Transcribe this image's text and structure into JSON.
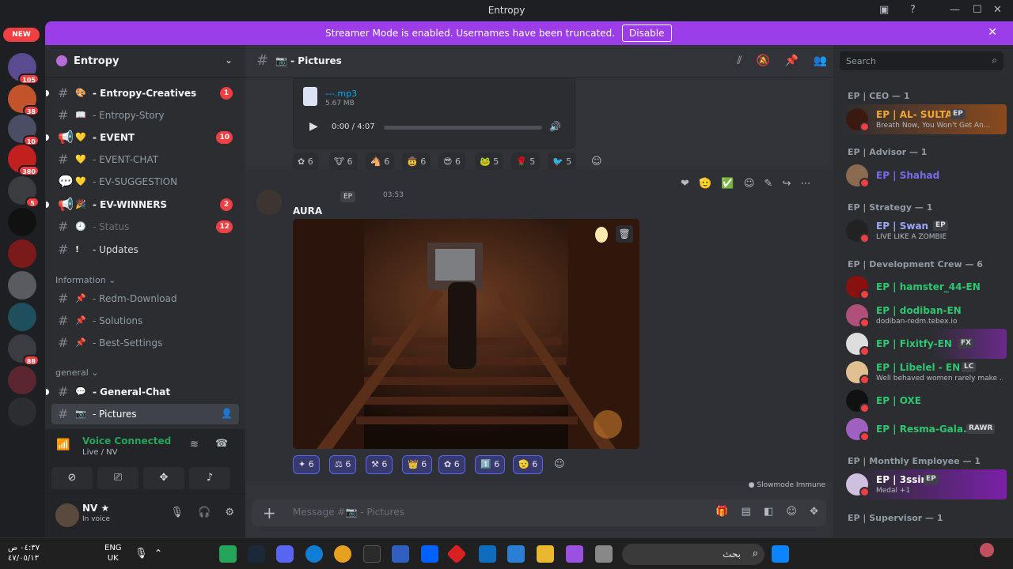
{
  "window": {
    "title": "Entropy"
  },
  "banner": {
    "message": "Streamer Mode is enabled. Usernames have been truncated.",
    "disable_label": "Disable"
  },
  "rail": {
    "new_label": "NEW",
    "badges": [
      "105",
      "38",
      "10",
      "380",
      "5",
      "88"
    ]
  },
  "guild": {
    "name": "Entropy"
  },
  "channels": [
    {
      "label": "- Entropy-Creatives",
      "count": "1"
    },
    {
      "label": "- Entropy-Story"
    },
    {
      "label": "- EVENT",
      "count": "10"
    },
    {
      "label": "- EVENT-CHAT"
    },
    {
      "label": "- EV-SUGGESTION"
    },
    {
      "label": "- EV-WINNERS",
      "count": "2"
    },
    {
      "label": "- Status",
      "count": "12"
    },
    {
      "label": "- Updates"
    }
  ],
  "categories": {
    "information": "Information",
    "general": "general"
  },
  "info_channels": [
    "- Redm-Download",
    "- Solutions",
    "- Best-Settings"
  ],
  "general_channels": [
    "- General-Chat",
    "- Pictures"
  ],
  "voice": {
    "status": "Voice Connected",
    "location": "Live / NV"
  },
  "user": {
    "name": "NV ★",
    "status": "In voice"
  },
  "channel_header": {
    "name": "- Pictures"
  },
  "audio": {
    "filename": "---.mp3",
    "size": "5.67 MB",
    "time": "0:00 / 4:07"
  },
  "reactions_top": [
    "6",
    "6",
    "6",
    "6",
    "6",
    "5",
    "5",
    "5"
  ],
  "message": {
    "tag": "EP",
    "time": "03:53",
    "text": "AURA"
  },
  "reactions_bottom": [
    "6",
    "6",
    "6",
    "6",
    "6",
    "6",
    "6"
  ],
  "slowmode": "Slowmode Immune",
  "composer": {
    "placeholder": "Message #📷 - Pictures"
  },
  "search": {
    "placeholder": "Search"
  },
  "member_groups": {
    "ceo": "EP | CEO — 1",
    "advisor": "EP | Advisor — 1",
    "strategy": "EP | Strategy — 1",
    "dev": "EP | Development Crew — 6",
    "monthly": "EP | Monthly Employee — 1",
    "supervisor": "EP | Supervisor — 1"
  },
  "members": {
    "ceo": {
      "name": "EP | AL- SULTAN",
      "tag": "EP",
      "status": "Breath Now, You Won't Get An..."
    },
    "advisor": {
      "name": "EP | Shahad"
    },
    "strategy": {
      "name": "EP | Swan",
      "tag": "EP",
      "status": "LIVE LIKE A ZOMBIE"
    },
    "dev1": {
      "name": "EP | hamster_44-EN"
    },
    "dev2": {
      "name": "EP | dodiban-EN",
      "status": "dodiban-redm.tebex.io"
    },
    "dev3": {
      "name": "EP | Fixitfy-EN",
      "tag": "FX"
    },
    "dev4": {
      "name": "EP | Libelel - EN",
      "tag": "LC",
      "status": "Well behaved women rarely make ..."
    },
    "dev5": {
      "name": "EP | OXE"
    },
    "dev6": {
      "name": "EP | Resma-Gala...",
      "tag": "RAWR"
    },
    "monthly": {
      "name": "EP | 3ssiri",
      "tag": "EP",
      "status": "Medal +1"
    }
  },
  "taskbar": {
    "time": "٠٤:٣٧ ص",
    "date": "٤٧/٠٥/١٣",
    "lang1": "ENG",
    "lang2": "UK",
    "search": "بحث"
  },
  "colors": {
    "banner": "#9b3de8",
    "accent": "#5865f2",
    "online": "#23a55a",
    "badge": "#f23f43",
    "member_green": "#2dc770",
    "ceo_gold": "#f0a732"
  }
}
